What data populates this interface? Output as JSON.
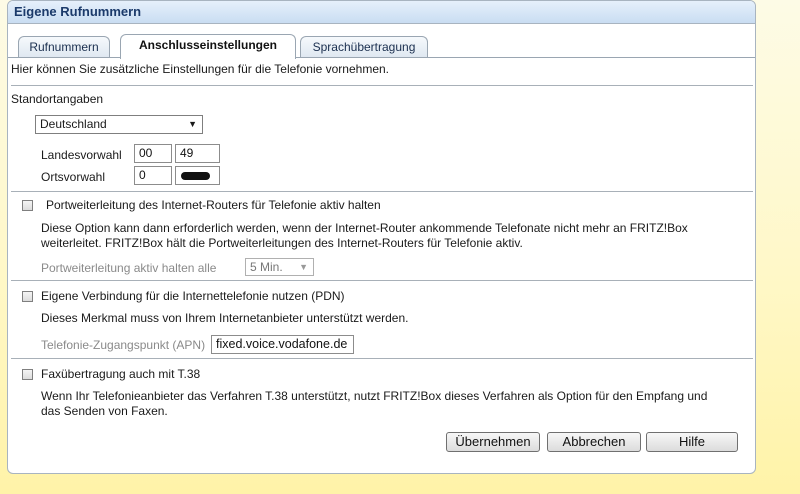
{
  "window": {
    "title": "Eigene Rufnummern"
  },
  "tabs": [
    {
      "label": "Rufnummern",
      "active": false
    },
    {
      "label": "Anschlusseinstellungen",
      "active": true
    },
    {
      "label": "Sprachübertragung",
      "active": false
    }
  ],
  "intro": "Hier können Sie zusätzliche Einstellungen für die Telefonie vornehmen.",
  "location": {
    "heading": "Standortangaben",
    "country": {
      "selected": "Deutschland"
    },
    "landesvorwahl": {
      "label": "Landesvorwahl",
      "prefix": "00",
      "code": "49"
    },
    "ortsvorwahl": {
      "label": "Ortsvorwahl",
      "prefix": "0",
      "code_redacted": true
    }
  },
  "portforwarding": {
    "checked": false,
    "label": "Portweiterleitung des Internet-Routers für Telefonie aktiv halten",
    "description_line1": "Diese Option kann dann erforderlich werden, wenn der Internet-Router ankommende Telefonate nicht mehr an FRITZ!Box",
    "description_line2": "weiterleitet. FRITZ!Box hält die Portweiterleitungen des Internet-Routers für Telefonie aktiv.",
    "interval_label": "Portweiterleitung aktiv halten alle",
    "interval_value": "5 Min."
  },
  "pdn": {
    "checked": false,
    "label": "Eigene Verbindung für die Internettelefonie nutzen (PDN)",
    "description": "Dieses Merkmal muss von Ihrem Internetanbieter unterstützt werden.",
    "apn_label": "Telefonie-Zugangspunkt (APN)",
    "apn_value": "fixed.voice.vodafone.de"
  },
  "fax": {
    "checked": false,
    "label": "Faxübertragung auch mit T.38",
    "description_line1": "Wenn Ihr Telefonieanbieter das Verfahren T.38 unterstützt, nutzt FRITZ!Box dieses Verfahren als Option für den Empfang und",
    "description_line2": "das Senden von Faxen."
  },
  "buttons": {
    "apply": "Übernehmen",
    "cancel": "Abbrechen",
    "help": "Hilfe"
  }
}
